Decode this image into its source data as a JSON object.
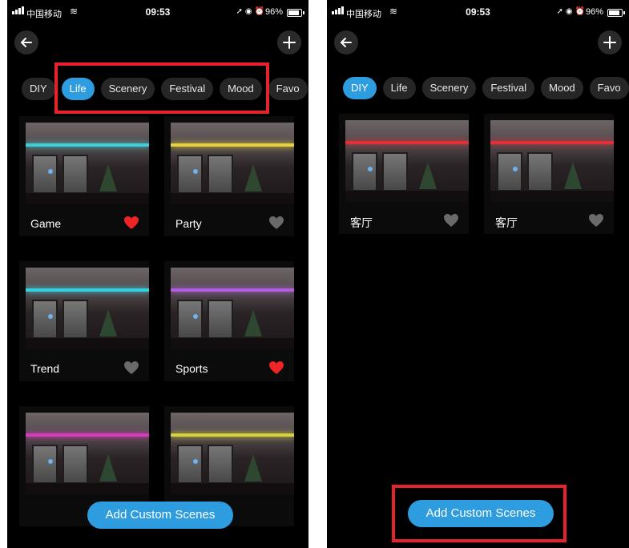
{
  "screen1": {
    "status": {
      "carrier": "中国移动",
      "time": "09:53",
      "battery": "96%"
    },
    "tabs": [
      "DIY",
      "Life",
      "Scenery",
      "Festival",
      "Mood",
      "Favo"
    ],
    "active_tab": "Life",
    "cards": [
      {
        "name": "Game",
        "favorite": true,
        "light": "#3ecfd6"
      },
      {
        "name": "Party",
        "favorite": false,
        "light": "#e6d23a"
      },
      {
        "name": "Trend",
        "favorite": false,
        "light": "#36d0e0"
      },
      {
        "name": "Sports",
        "favorite": true,
        "light": "#b35de0"
      },
      {
        "name": "",
        "favorite": false,
        "light": "#d83bbd"
      },
      {
        "name": "",
        "favorite": false,
        "light": "#d8d23a"
      }
    ],
    "add_button": "Add Custom Scenes"
  },
  "screen2": {
    "status": {
      "carrier": "中国移动",
      "time": "09:53",
      "battery": "96%"
    },
    "tabs": [
      "DIY",
      "Life",
      "Scenery",
      "Festival",
      "Mood",
      "Favo"
    ],
    "active_tab": "DIY",
    "cards": [
      {
        "name": "客厅",
        "favorite": false,
        "light": "#e0303a"
      },
      {
        "name": "客厅",
        "favorite": false,
        "light": "#e0303a"
      }
    ],
    "add_button": "Add Custom Scenes"
  },
  "colors": {
    "accent": "#2e9de0",
    "highlight": "#e6232a",
    "heart_on": "#ee2426",
    "heart_off": "#6a6a6a"
  }
}
